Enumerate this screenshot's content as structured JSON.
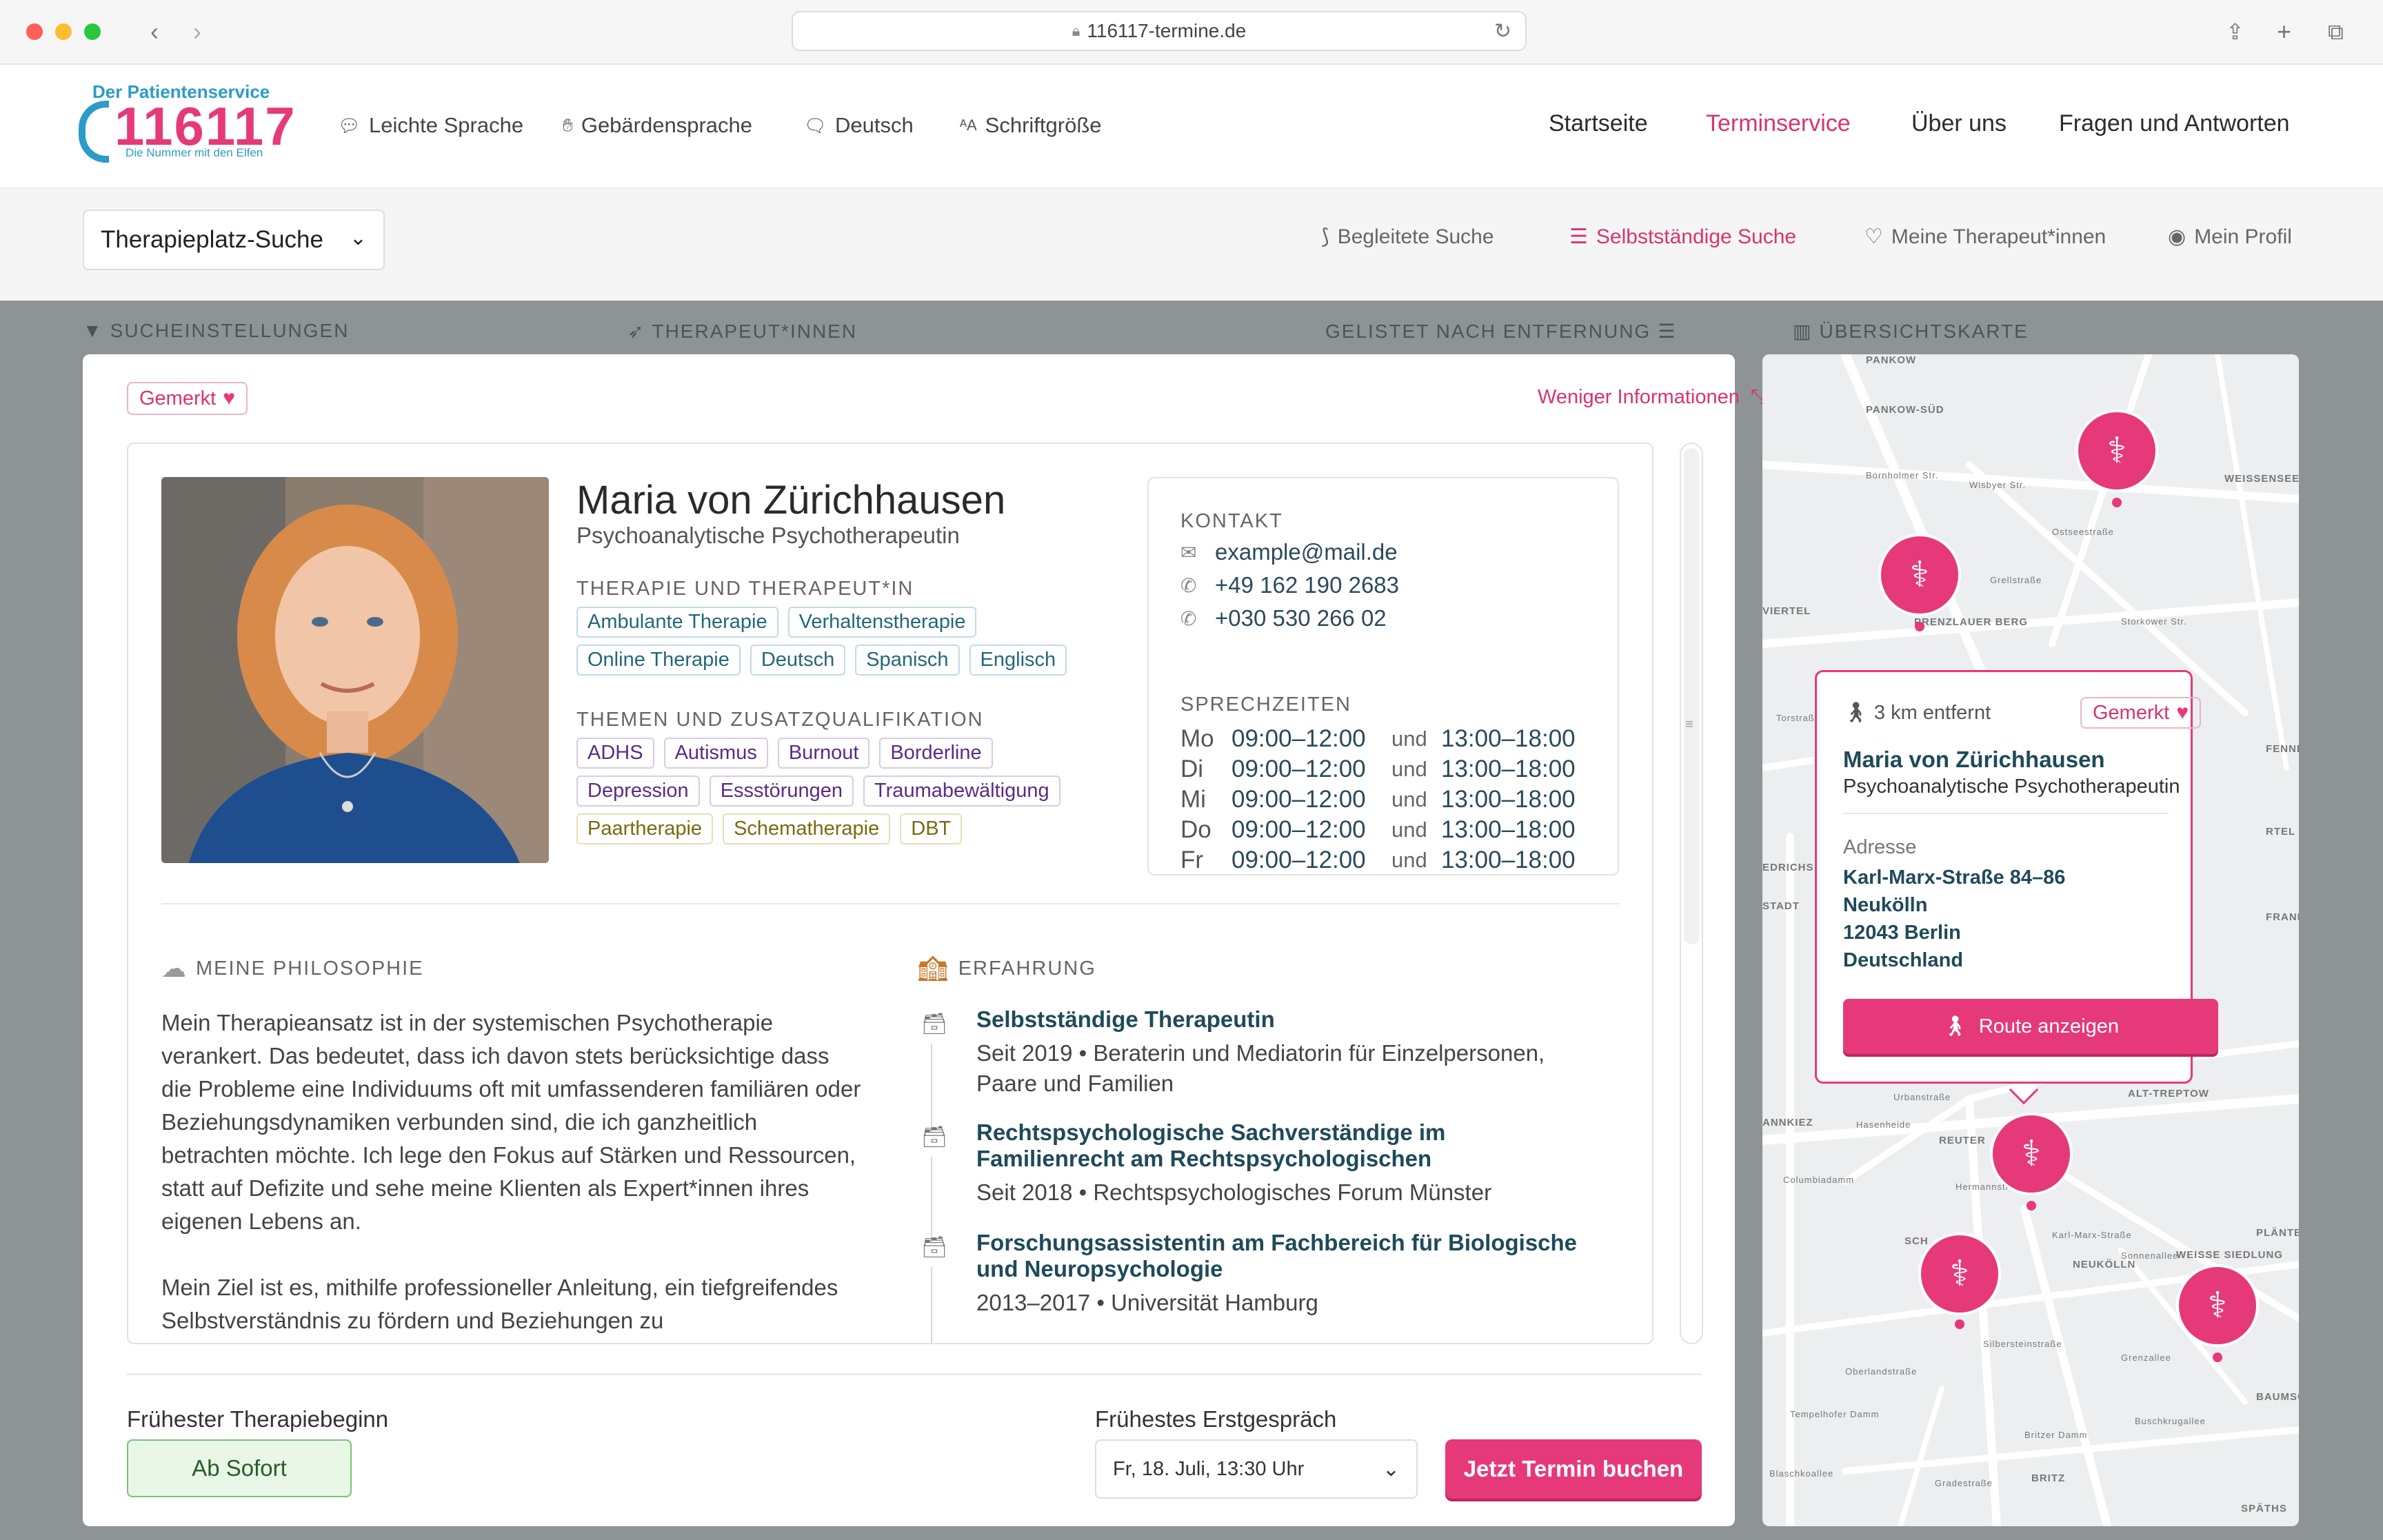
{
  "browser": {
    "url": "116117-termine.de"
  },
  "logo": {
    "tagline_top": "Der Patientenservice",
    "number": "116117",
    "tagline_bottom": "Die Nummer mit den Elfen"
  },
  "header_tools": [
    {
      "label": "Leichte Sprache",
      "icon": "speech-bubble-icon"
    },
    {
      "label": "Gebärdensprache",
      "icon": "sign-language-icon"
    },
    {
      "label": "Deutsch",
      "icon": "language-icon"
    },
    {
      "label": "Schriftgröße",
      "icon": "font-size-icon"
    }
  ],
  "nav": [
    {
      "label": "Startseite",
      "active": false
    },
    {
      "label": "Terminservice",
      "active": true
    },
    {
      "label": "Über uns",
      "active": false
    },
    {
      "label": "Fragen und Antworten",
      "active": false
    }
  ],
  "subheader": {
    "dropdown": "Therapieplatz-Suche",
    "links": [
      {
        "label": "Begleitete Suche",
        "icon": "route-icon",
        "active": false
      },
      {
        "label": "Selbstständige Suche",
        "icon": "sliders-icon",
        "active": true
      },
      {
        "label": "Meine Therapeut*innen",
        "icon": "heart-outline-icon",
        "active": false
      },
      {
        "label": "Mein Profil",
        "icon": "user-circle-icon",
        "active": false
      }
    ]
  },
  "sections": {
    "settings": "SUCHEINSTELLUNGEN",
    "therapists": "THERAPEUT*INNEN",
    "sorted": "GELISTET NACH ENTFERNUNG",
    "map": "ÜBERSICHTSKARTE"
  },
  "card": {
    "gemerkt": "Gemerkt",
    "less_info": "Weniger Informationen",
    "name": "Maria von Zürichhausen",
    "title": "Psychoanalytische Psychotherapeutin",
    "therapy_label": "THERAPIE UND THERAPEUT*IN",
    "therapy_tags": [
      "Ambulante Therapie",
      "Verhaltenstherapie",
      "Online Therapie",
      "Deutsch",
      "Spanisch",
      "Englisch"
    ],
    "topics_label": "THEMEN UND ZUSATZQUALIFIKATION",
    "topic_tags_purple": [
      "ADHS",
      "Autismus",
      "Burnout",
      "Borderline",
      "Depression",
      "Essstörungen",
      "Traumabewältigung"
    ],
    "topic_tags_yellow": [
      "Paartherapie",
      "Schematherapie",
      "DBT"
    ],
    "contact": {
      "label": "KONTAKT",
      "email": "example@mail.de",
      "phone1": "+49 162 190 2683",
      "phone2": "+030 530 266 02",
      "hours_label": "SPRECHZEITEN",
      "hours": [
        {
          "day": "Mo",
          "am": "09:00–12:00",
          "und": "und",
          "pm": "13:00–18:00"
        },
        {
          "day": "Di",
          "am": "09:00–12:00",
          "und": "und",
          "pm": "13:00–18:00"
        },
        {
          "day": "Mi",
          "am": "09:00–12:00",
          "und": "und",
          "pm": "13:00–18:00"
        },
        {
          "day": "Do",
          "am": "09:00–12:00",
          "und": "und",
          "pm": "13:00–18:00"
        },
        {
          "day": "Fr",
          "am": "09:00–12:00",
          "und": "und",
          "pm": "13:00–18:00"
        }
      ]
    },
    "philosophy_label": "MEINE PHILOSOPHIE",
    "philosophy_p1": "Mein Therapieansatz ist in der systemischen Psychotherapie verankert. Das bedeutet, dass ich davon stets berücksichtige dass die Probleme eine Individuums oft mit umfassenderen familiären oder Beziehungsdynamiken verbunden sind, die ich ganzheitlich betrachten möchte. Ich lege den Fokus auf Stärken und Ressourcen, statt auf Defizite und sehe meine Klienten als Expert*innen ihres eigenen Lebens an.",
    "philosophy_p2": "Mein Ziel ist es, mithilfe professioneller Anleitung, ein tiefgreifendes Selbstverständnis zu fördern und Beziehungen zu",
    "experience_label": "ERFAHRUNG",
    "experience": [
      {
        "title": "Selbstständige Therapeutin",
        "sub": "Seit 2019 • Beraterin und Mediatorin für Einzelpersonen, Paare und Familien"
      },
      {
        "title": "Rechtspsychologische Sachverständige im Familienrecht am Rechtspsychologischen",
        "sub": "Seit 2018 • Rechtspsychologisches Forum Münster"
      },
      {
        "title": "Forschungsassistentin am Fachbereich für Biologische und Neuropsychologie",
        "sub": "2013–2017 • Universität Hamburg"
      }
    ]
  },
  "footer": {
    "start_label": "Frühester Therapiebeginn",
    "start_value": "Ab Sofort",
    "appointment_label": "Frühestes Erstgespräch",
    "appointment_value": "Fr, 18. Juli, 13:30 Uhr",
    "book_button": "Jetzt Termin buchen"
  },
  "map": {
    "areas": [
      "PANKOW",
      "PANKOW-SÜD",
      "WEISSENSEE",
      "PRENZLAUER BERG",
      "VIERTEL",
      "FENNP",
      "RTEL",
      "EDRICHS",
      "STADT",
      "FRANK ALL",
      "ALT-TREPTOW",
      "ANNKIEZ",
      "REUTER",
      "NEUKÖLLN",
      "WEISSE SIEDLUNG",
      "PLÄNTER",
      "BAUMSC",
      "BRITZ",
      "SPÄTHS",
      "SCH"
    ],
    "streets": [
      "Bornholmer Str.",
      "Wisbyer Str.",
      "Ostseestraße",
      "Grellstraße",
      "Storkower Str.",
      "Torstraße",
      "Urbanstraße",
      "Hasenheide",
      "Columbiadamm",
      "Hermannstraße",
      "Karl-Marx-Straße",
      "Sonnenallee",
      "Silbersteinstraße",
      "Oberlandstraße",
      "Grenzallee",
      "Buschkrugallee",
      "Gradestraße",
      "Britzer Damm",
      "Tempelhofer Damm",
      "Blaschkoallee"
    ],
    "popup": {
      "distance": "3 km entfernt",
      "gemerkt": "Gemerkt",
      "name": "Maria von Zürichhausen",
      "title": "Psychoanalytische Psychotherapeutin",
      "address_label": "Adresse",
      "address": [
        "Karl-Marx-Straße 84–86",
        "Neukölln",
        "12043 Berlin",
        "Deutschland"
      ],
      "route_button": "Route anzeigen"
    }
  },
  "colors": {
    "brand_pink": "#e6397a",
    "brand_blue": "#2c9bc9",
    "dark_teal": "#1f4a5a"
  }
}
